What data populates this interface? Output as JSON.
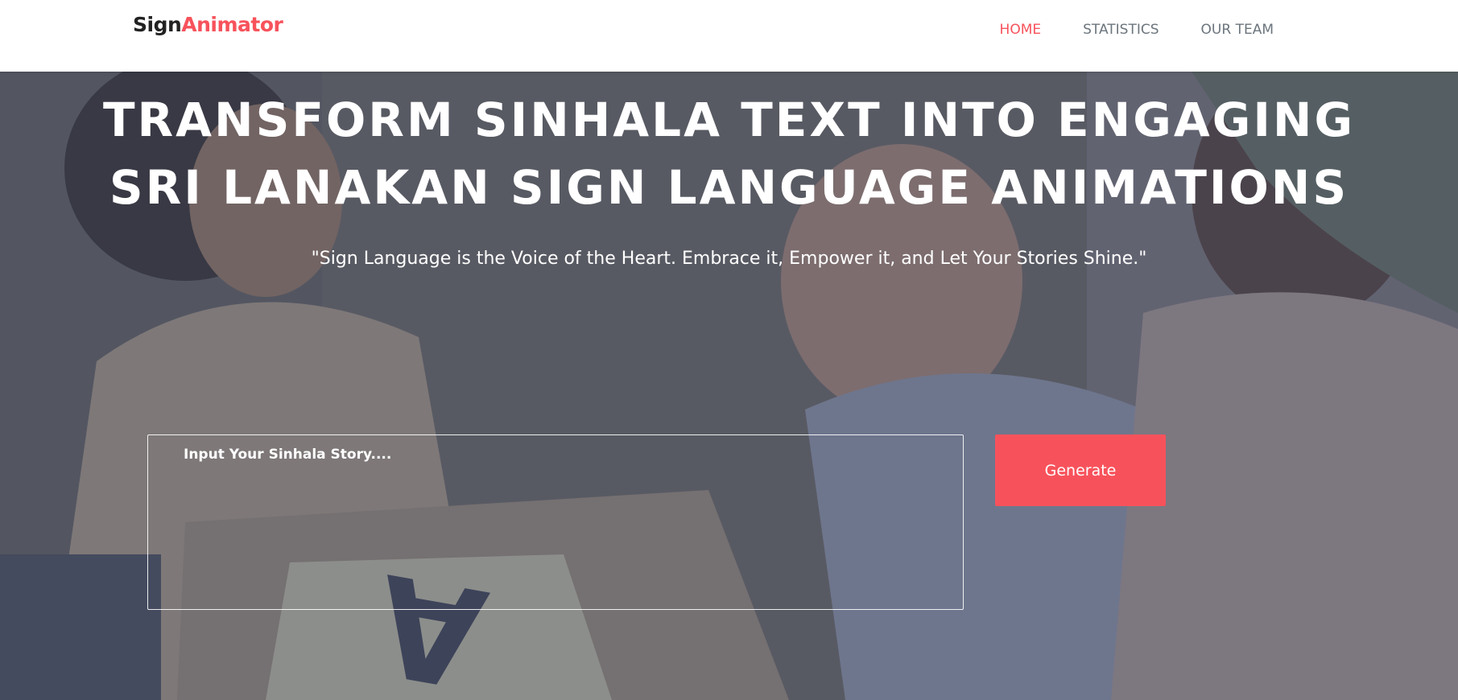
{
  "brand": {
    "name_part1": "Sign",
    "name_part2": "Animator",
    "accent_color": "#f7525b"
  },
  "nav": {
    "items": [
      {
        "label": "HOME",
        "active": true
      },
      {
        "label": "STATISTICS",
        "active": false
      },
      {
        "label": "OUR TEAM",
        "active": false
      }
    ]
  },
  "hero": {
    "title_line1": "TRANSFORM SINHALA TEXT INTO ENGAGING",
    "title_line2": "SRI LANAKAN SIGN LANGUAGE ANIMATIONS",
    "quote": "\"Sign Language is the Voice of the Heart. Embrace it, Empower it, and Let Your Stories Shine.\"",
    "input_placeholder": "Input Your Sinhala Story....",
    "input_value": "",
    "generate_label": "Generate"
  }
}
